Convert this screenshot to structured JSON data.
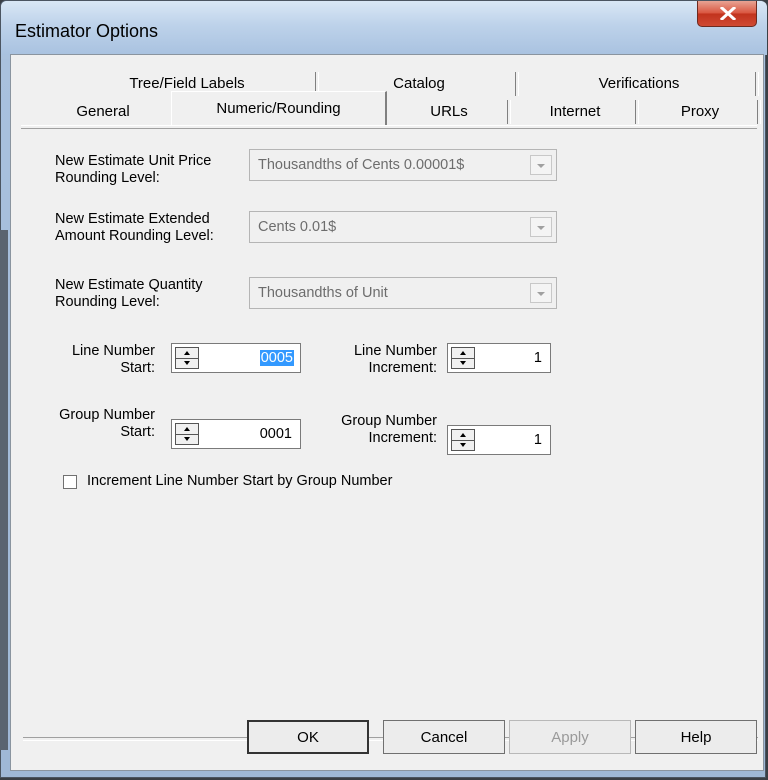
{
  "window": {
    "title": "Estimator Options"
  },
  "tabs_row1": [
    {
      "label": "Tree/Field Labels"
    },
    {
      "label": "Catalog"
    },
    {
      "label": "Verifications"
    }
  ],
  "tabs_row2": [
    {
      "label": "General"
    },
    {
      "label": "Numeric/Rounding",
      "active": true
    },
    {
      "label": "URLs"
    },
    {
      "label": "Internet"
    },
    {
      "label": "Proxy"
    }
  ],
  "fields": {
    "unit_price_label": "New Estimate Unit Price\nRounding Level:",
    "unit_price_value": "Thousandths of Cents 0.00001$",
    "extended_label": "New Estimate Extended\nAmount Rounding Level:",
    "extended_value": "Cents 0.01$",
    "quantity_label": "New Estimate Quantity\nRounding Level:",
    "quantity_value": "Thousandths of Unit",
    "line_start_label": "Line Number\nStart:",
    "line_start_value": "0005",
    "line_inc_label": "Line Number\nIncrement:",
    "line_inc_value": "1",
    "group_start_label": "Group Number\nStart:",
    "group_start_value": "0001",
    "group_inc_label": "Group Number\nIncrement:",
    "group_inc_value": "1",
    "increment_checkbox_label": "Increment Line Number Start by Group Number",
    "increment_checked": false
  },
  "buttons": {
    "ok": "OK",
    "cancel": "Cancel",
    "apply": "Apply",
    "help": "Help"
  },
  "colors": {
    "selection": "#3399ff",
    "close_button": "#c1321d"
  }
}
